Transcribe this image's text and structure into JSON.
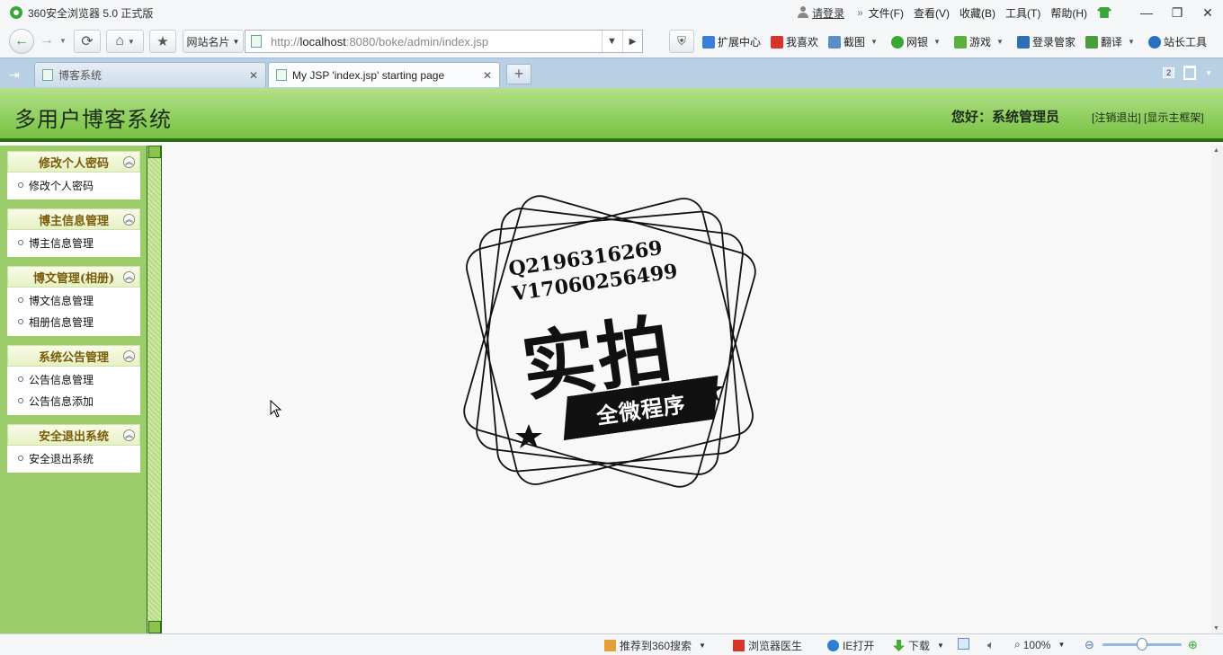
{
  "browser": {
    "title": "360安全浏览器 5.0 正式版",
    "login": "请登录",
    "menus": [
      "文件(F)",
      "查看(V)",
      "收藏(B)",
      "工具(T)",
      "帮助(H)"
    ],
    "window_controls": {
      "minimize": "—",
      "restore": "❐",
      "close": "✕"
    }
  },
  "toolbar": {
    "site_cards": "网站名片",
    "url_host": "http://",
    "url_bold": "localhost",
    "url_rest": ":8080/boke/admin/index.jsp",
    "extensions": [
      "扩展中心",
      "我喜欢",
      "截图",
      "网银",
      "游戏",
      "登录管家",
      "翻译",
      "站长工具"
    ]
  },
  "tabs": [
    {
      "label": "博客系统",
      "active": false
    },
    {
      "label": "My JSP 'index.jsp' starting page",
      "active": true
    }
  ],
  "tab_count": "2",
  "site": {
    "title": "多用户博客系统",
    "greeting": "您好：系统管理员",
    "logout_link": "[注销退出]",
    "frame_link": "[显示主框架]"
  },
  "sidebar": {
    "groups": [
      {
        "title": "修改个人密码",
        "items": [
          "修改个人密码"
        ]
      },
      {
        "title": "博主信息管理",
        "items": [
          "博主信息管理"
        ]
      },
      {
        "title": "博文管理(相册)",
        "items": [
          "博文信息管理",
          "相册信息管理"
        ]
      },
      {
        "title": "系统公告管理",
        "items": [
          "公告信息管理",
          "公告信息添加"
        ]
      },
      {
        "title": "安全退出系统",
        "items": [
          "安全退出系统"
        ]
      }
    ]
  },
  "stamp": {
    "line1": "Q2196316269",
    "line2": "V17060256499",
    "big": "实拍",
    "banner": "全微程序"
  },
  "statusbar": {
    "recommend": "推荐到360搜索",
    "doctor": "浏览器医生",
    "ie_open": "IE打开",
    "download": "下载",
    "zoom": "100%"
  },
  "colors": {
    "header_green": "#76c242",
    "header_border": "#2c6e14",
    "sidebar_green": "#9ccc6a",
    "group_title": "#7a5b08",
    "tabbar_blue": "#b9cfe3"
  }
}
